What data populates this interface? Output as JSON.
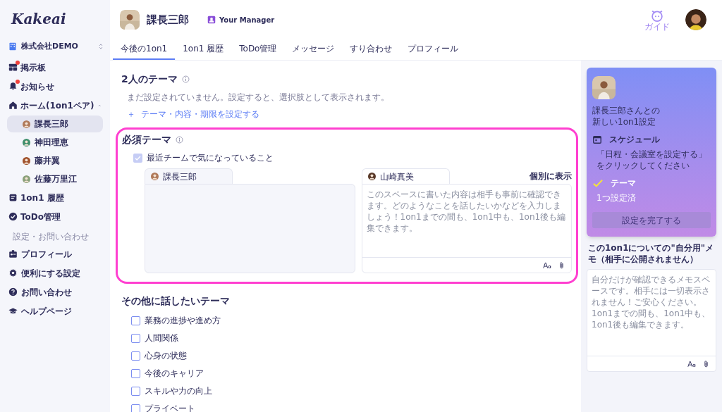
{
  "logo": "Kakeai",
  "company": {
    "name": "株式会社DEMO"
  },
  "nav": [
    {
      "label": "掲示板",
      "notification": true,
      "selected": false
    },
    {
      "label": "お知らせ",
      "notification": true,
      "selected": false
    },
    {
      "label": "ホーム(1on1ペア)",
      "notification": false,
      "selected": false,
      "expanded": true,
      "children": [
        {
          "label": "課長三郎",
          "selected": true
        },
        {
          "label": "神田理恵",
          "selected": false
        },
        {
          "label": "藤井翼",
          "selected": false
        },
        {
          "label": "佐藤万里江",
          "selected": false
        }
      ]
    },
    {
      "label": "1on1 履歴",
      "notification": false,
      "selected": false
    },
    {
      "label": "ToDo管理",
      "notification": false,
      "selected": false
    }
  ],
  "settings_section": {
    "title": "設定・お問い合わせ",
    "items": [
      {
        "label": "プロフィール"
      },
      {
        "label": "便利にする設定"
      },
      {
        "label": "お問い合わせ"
      },
      {
        "label": "ヘルプページ"
      }
    ]
  },
  "header": {
    "name": "課長三郎",
    "role": "Your Manager",
    "guide": "ガイド"
  },
  "tabs": [
    {
      "label": "今後の1on1",
      "selected": true
    },
    {
      "label": "1on1 履歴",
      "selected": false
    },
    {
      "label": "ToDo管理",
      "selected": false
    },
    {
      "label": "メッセージ",
      "selected": false
    },
    {
      "label": "すり合わせ",
      "selected": false
    },
    {
      "label": "プロフィール",
      "selected": false
    }
  ],
  "shared_theme": {
    "title": "2人のテーマ",
    "empty_text": "まだ設定されていません。設定すると、選択肢として表示されます。",
    "add_link": "＋  テーマ・内容・期限を設定する"
  },
  "required_theme": {
    "title": "必須テーマ",
    "item": {
      "label": "最近チームで気になっていること",
      "checked": true
    },
    "notes": [
      {
        "author": "課長三郎"
      },
      {
        "author": "山崎真美",
        "action": "個別に表示",
        "placeholder": "このスペースに書いた内容は相手も事前に確認できます。どのようなことを話したいかなどを入力しましょう！1on1までの間も、1on1中も、1on1後も編集できます。"
      }
    ]
  },
  "other_themes": {
    "title": "その他に話したいテーマ",
    "items": [
      {
        "label": "業務の進捗や進め方",
        "checked": false
      },
      {
        "label": "人間関係",
        "checked": false
      },
      {
        "label": "心身の状態",
        "checked": false
      },
      {
        "label": "今後のキャリア",
        "checked": false
      },
      {
        "label": "スキルや力の向上",
        "checked": false
      },
      {
        "label": "プライベート",
        "checked": false
      }
    ]
  },
  "setup_card": {
    "intro": [
      "課長三郎さんとの",
      "新しい1on1設定"
    ],
    "steps": [
      {
        "kind": "calendar",
        "title": "スケジュール",
        "lines": [
          "「日程・会議室を設定する」",
          "をクリックしてください"
        ],
        "done": false
      },
      {
        "kind": "check",
        "title": "テーマ",
        "lines": [
          "1つ設定済"
        ],
        "done": true
      }
    ],
    "button": "設定を完了する",
    "button_disabled": true
  },
  "memo": {
    "title": "この1on1についての\"自分用\"メモ（相手に公開されません）",
    "placeholder": "自分だけが確認できるメモスペースです。相手には一切表示されません！ご安心ください。1on1までの間も、1on1中も、1on1後も編集できます。"
  }
}
